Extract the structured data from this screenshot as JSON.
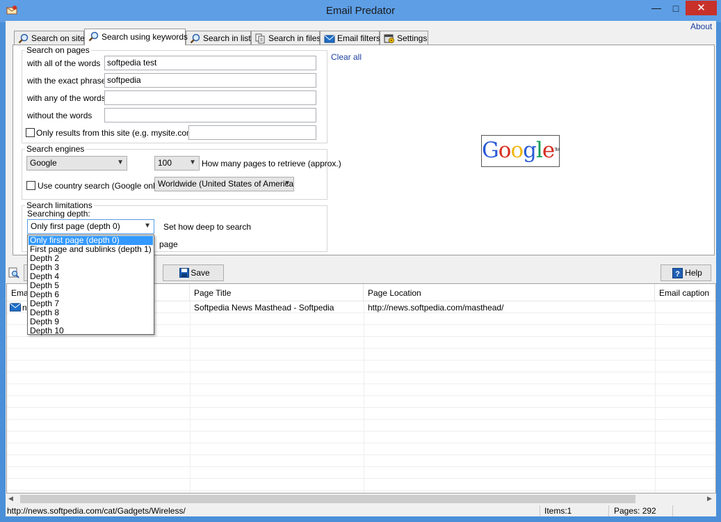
{
  "window": {
    "title": "Email Predator"
  },
  "menu": {
    "about": "About"
  },
  "tabs": [
    {
      "label": "Search on site",
      "icon": "magnifier-icon"
    },
    {
      "label": "Search using keywords",
      "icon": "magnifier-icon"
    },
    {
      "label": "Search in list",
      "icon": "magnifier-icon"
    },
    {
      "label": "Search in files",
      "icon": "files-icon"
    },
    {
      "label": "Email filters",
      "icon": "envelope-icon"
    },
    {
      "label": "Settings",
      "icon": "settings-icon"
    }
  ],
  "search_on_pages": {
    "title": "Search on pages",
    "all_words_label": "with all of the words",
    "all_words_value": "softpedia test",
    "exact_phrase_label": "with the exact phrase",
    "exact_phrase_value": "softpedia",
    "any_words_label": "with any of the words",
    "any_words_value": "",
    "without_words_label": "without the words",
    "without_words_value": "",
    "only_site_label": "Only results from this site (e.g. mysite.com)",
    "only_site_value": ""
  },
  "search_engines": {
    "title": "Search engines",
    "engine": "Google",
    "pages": "100",
    "pages_label": "How many pages to retrieve (approx.)",
    "country_label": "Use country search  (Google only)",
    "country": "Worldwide (United States of America)"
  },
  "search_limitations": {
    "title": "Search limitations",
    "depth_label": "Searching depth:",
    "depth_value": "Only first page (depth 0)",
    "depth_hint": "Set how deep to search",
    "partial_text": "page",
    "depth_options": [
      "Only first page (depth 0)",
      "First page and sublinks (depth 1)",
      "Depth 2",
      "Depth 3",
      "Depth 4",
      "Depth 5",
      "Depth 6",
      "Depth 7",
      "Depth 8",
      "Depth 9",
      "Depth 10"
    ]
  },
  "right_panel": {
    "clear_all": "Clear all",
    "logo_text": "Google"
  },
  "toolbar": {
    "save_label": "Save",
    "help_label": "Help"
  },
  "table": {
    "columns": [
      "Email",
      "Page Title",
      "Page Location",
      "Email caption"
    ],
    "rows": [
      {
        "email_visible": "n",
        "page_title": "Softpedia News Masthead - Softpedia",
        "page_location": "http://news.softpedia.com/masthead/",
        "caption": ""
      }
    ]
  },
  "status": {
    "url": "http://news.softpedia.com/cat/Gadgets/Wireless/",
    "items": "Items:1",
    "pages": "Pages: 292"
  },
  "colors": {
    "titlebar": "#5d9ee5",
    "close_button": "#c7312a",
    "selection": "#3399ff",
    "link": "#1a3fa0"
  }
}
